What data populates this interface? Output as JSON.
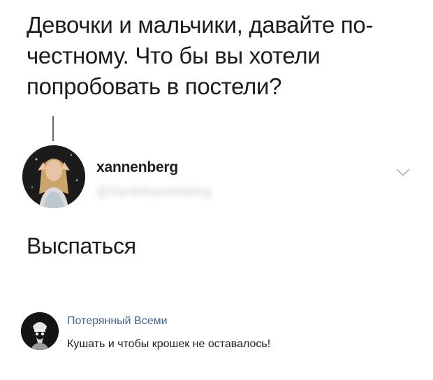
{
  "tweet": {
    "question": "Девочки и мальчики, давайте по-честному. Что бы вы хотели попробовать в постели?",
    "reply": {
      "username": "xannenberg",
      "handle": "@SarahKannenberg",
      "text": "Выспаться",
      "avatar_icon": "profile-photo-woman",
      "menu_icon": "chevron-down-icon"
    }
  },
  "vk_comment": {
    "author": "Потерянный Всеми",
    "text": "Кушать и чтобы крошек не оставалось!",
    "avatar_icon": "profile-photo-dark",
    "name_color": "#41648f"
  }
}
